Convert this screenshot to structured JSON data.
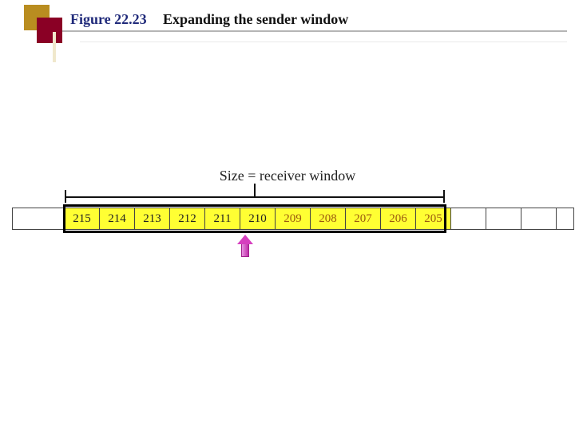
{
  "header": {
    "figure_number": "Figure 22.23",
    "figure_title": "Expanding the sender window"
  },
  "diagram": {
    "size_label": "Size = receiver window",
    "window_cells": [
      {
        "v": "215",
        "cls": "bk"
      },
      {
        "v": "214",
        "cls": "bk"
      },
      {
        "v": "213",
        "cls": "bk"
      },
      {
        "v": "212",
        "cls": "bk"
      },
      {
        "v": "211",
        "cls": "bk"
      },
      {
        "v": "210",
        "cls": "bk"
      },
      {
        "v": "209",
        "cls": "br"
      },
      {
        "v": "208",
        "cls": "br"
      },
      {
        "v": "207",
        "cls": "br"
      },
      {
        "v": "206",
        "cls": "br"
      },
      {
        "v": "205",
        "cls": "br"
      }
    ],
    "outside_right_count": 3,
    "pointer_under_value": "210"
  }
}
